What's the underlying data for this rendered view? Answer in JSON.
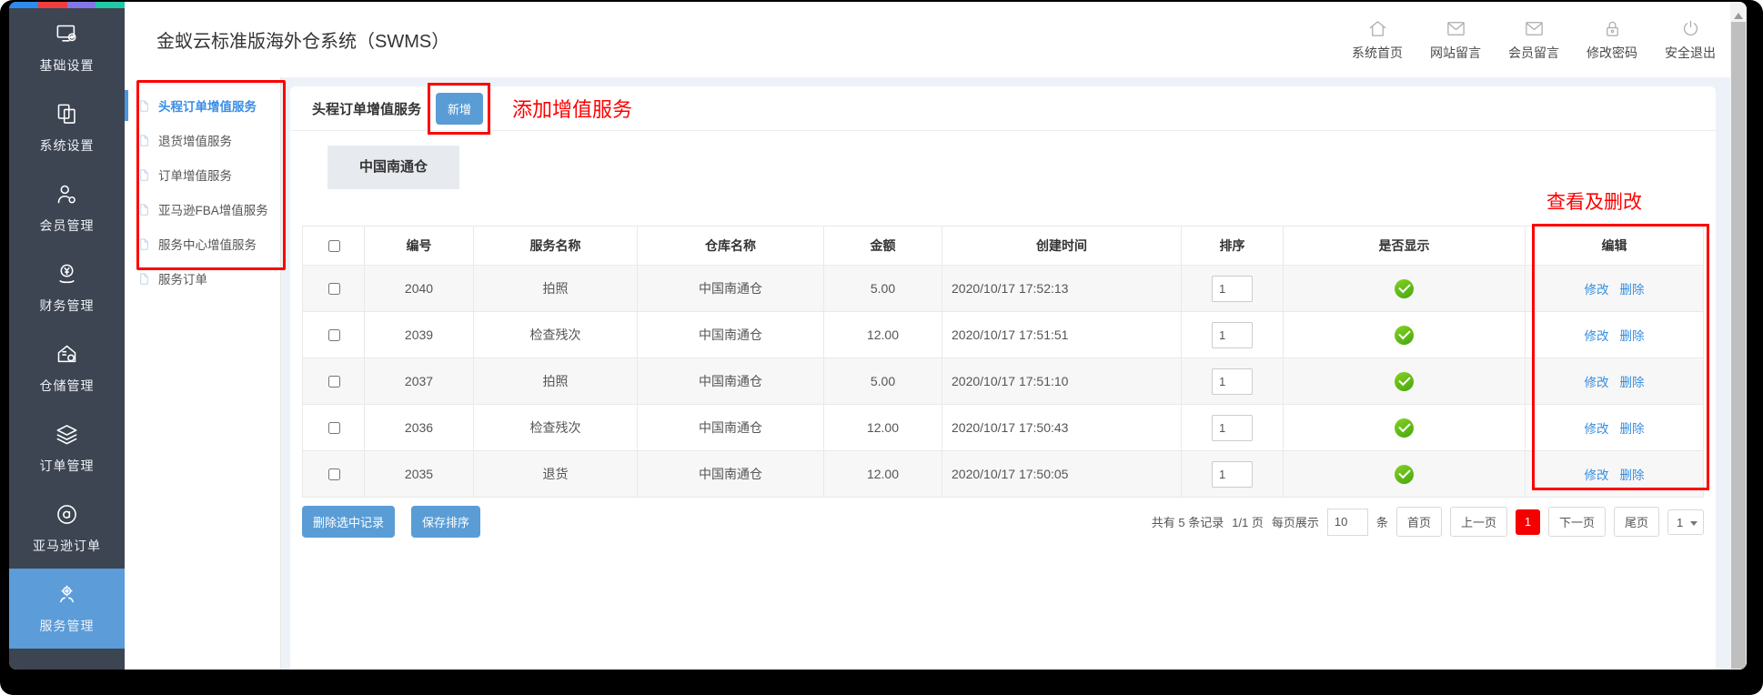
{
  "app": {
    "title": "金蚁云标准版海外仓系统（SWMS）"
  },
  "topbar": {
    "links": [
      {
        "label": "系统首页",
        "icon": "home-icon"
      },
      {
        "label": "网站留言",
        "icon": "mail-icon"
      },
      {
        "label": "会员留言",
        "icon": "mail-icon"
      },
      {
        "label": "修改密码",
        "icon": "lock-icon"
      },
      {
        "label": "安全退出",
        "icon": "power-icon"
      }
    ]
  },
  "sidebar": {
    "items": [
      {
        "label": "基础设置",
        "icon": "monitor-gear-icon",
        "active": false
      },
      {
        "label": "系统设置",
        "icon": "copy-icon",
        "active": false
      },
      {
        "label": "会员管理",
        "icon": "user-gear-icon",
        "active": false
      },
      {
        "label": "财务管理",
        "icon": "finance-icon",
        "active": false
      },
      {
        "label": "仓储管理",
        "icon": "warehouse-gear-icon",
        "active": false
      },
      {
        "label": "订单管理",
        "icon": "layers-icon",
        "active": false
      },
      {
        "label": "亚马逊订单",
        "icon": "amazon-icon",
        "active": false
      },
      {
        "label": "服务管理",
        "icon": "service-gear-icon",
        "active": true
      }
    ]
  },
  "subnav": {
    "items": [
      {
        "label": "头程订单增值服务",
        "active": true
      },
      {
        "label": "退货增值服务",
        "active": false
      },
      {
        "label": "订单增值服务",
        "active": false
      },
      {
        "label": "亚马逊FBA增值服务",
        "active": false
      },
      {
        "label": "服务中心增值服务",
        "active": false
      },
      {
        "label": "服务订单",
        "active": false
      }
    ]
  },
  "panel": {
    "title": "头程订单增值服务",
    "add_button": "新增"
  },
  "annotations": {
    "add_service": "添加增值服务",
    "view_edit": "查看及删改"
  },
  "warehouse_tab": {
    "label": "中国南通仓"
  },
  "table": {
    "headers": [
      "编号",
      "服务名称",
      "仓库名称",
      "金额",
      "创建时间",
      "排序",
      "是否显示",
      "编辑"
    ],
    "edit_actions": {
      "modify": "修改",
      "delete": "删除"
    },
    "rows": [
      {
        "id": "2040",
        "service": "拍照",
        "warehouse": "中国南通仓",
        "amount": "5.00",
        "created": "2020/10/17 17:52:13",
        "sort": "1",
        "visible": true
      },
      {
        "id": "2039",
        "service": "检查残次",
        "warehouse": "中国南通仓",
        "amount": "12.00",
        "created": "2020/10/17 17:51:51",
        "sort": "1",
        "visible": true
      },
      {
        "id": "2037",
        "service": "拍照",
        "warehouse": "中国南通仓",
        "amount": "5.00",
        "created": "2020/10/17 17:51:10",
        "sort": "1",
        "visible": true
      },
      {
        "id": "2036",
        "service": "检查残次",
        "warehouse": "中国南通仓",
        "amount": "12.00",
        "created": "2020/10/17 17:50:43",
        "sort": "1",
        "visible": true
      },
      {
        "id": "2035",
        "service": "退货",
        "warehouse": "中国南通仓",
        "amount": "12.00",
        "created": "2020/10/17 17:50:05",
        "sort": "1",
        "visible": true
      }
    ]
  },
  "footer": {
    "delete_selected": "删除选中记录",
    "save_sort": "保存排序"
  },
  "pagination": {
    "summary": "共有 5 条记录",
    "page_info": "1/1 页",
    "per_page_label": "每页展示",
    "per_page_value": "10",
    "unit": "条",
    "first": "首页",
    "prev": "上一页",
    "current_page": "1",
    "next": "下一页",
    "last": "尾页",
    "page_select": "1"
  },
  "colors": {
    "sidebar_bg": "#3d4452",
    "sidebar_active": "#5b9cd9",
    "primary_button": "#5a9dd6",
    "link_blue": "#368ee0",
    "annotation_red": "#fe0000",
    "pagination_active": "#f40000",
    "success_green": "#52b80c",
    "title_strip": [
      "#2d8cf0",
      "#f03e3e",
      "#8276e8",
      "#20c9a6"
    ]
  }
}
